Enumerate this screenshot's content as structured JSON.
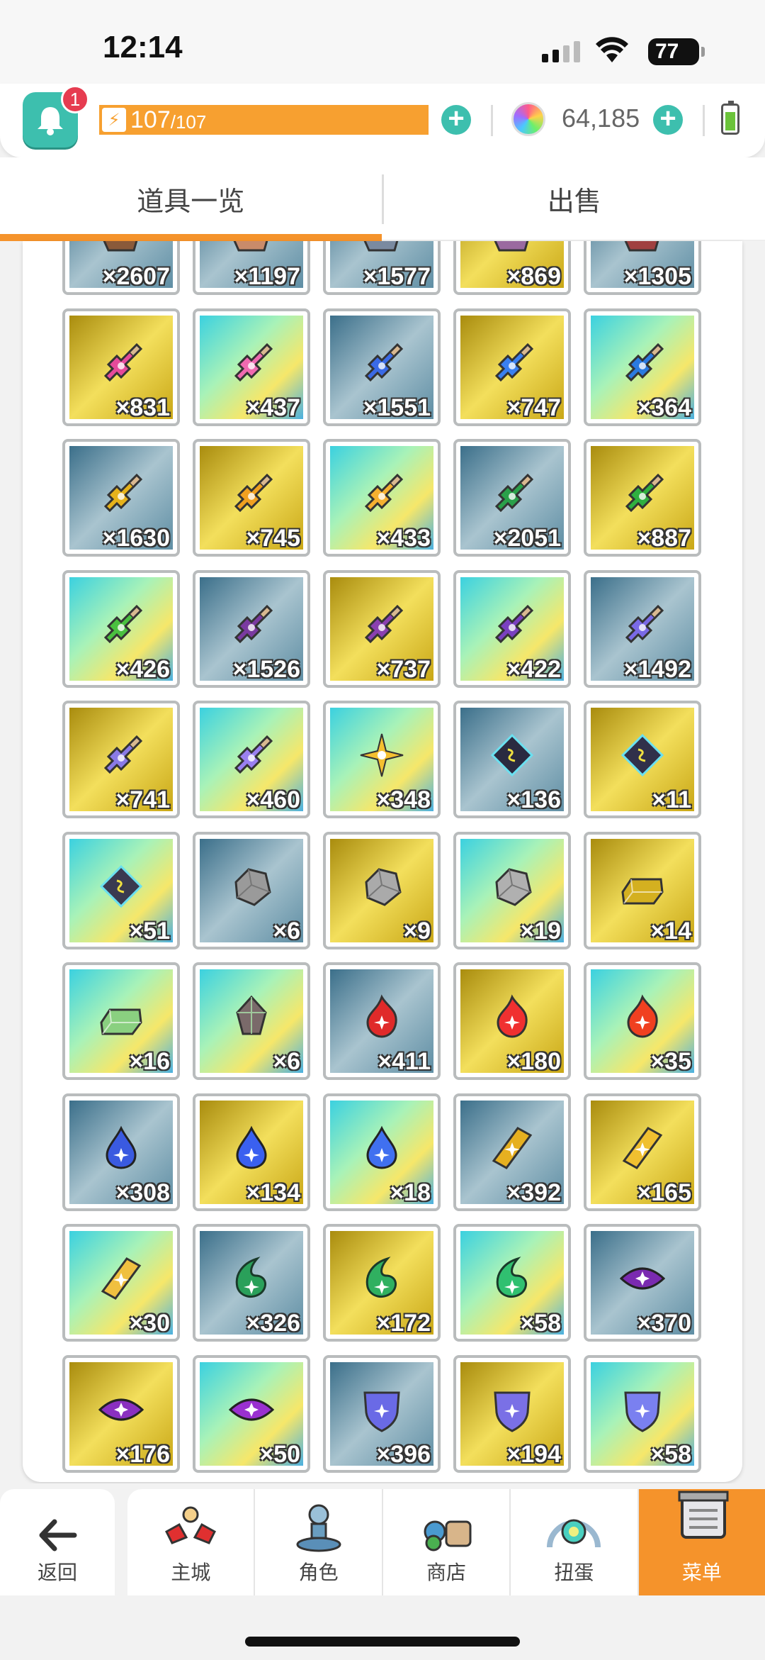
{
  "status_bar": {
    "time": "12:14",
    "battery": "77"
  },
  "header": {
    "notification_count": "1",
    "stamina_current": "107",
    "stamina_max": "/107",
    "gems": "64,185"
  },
  "tabs": [
    {
      "label": "道具一览",
      "active": true
    },
    {
      "label": "出售",
      "active": false
    }
  ],
  "items": [
    {
      "count": "×2607",
      "bg": "r",
      "icon": "material-icon",
      "color": "#8a5a3a"
    },
    {
      "count": "×1197",
      "bg": "r",
      "icon": "material-icon",
      "color": "#c98b6a"
    },
    {
      "count": "×1577",
      "bg": "r",
      "icon": "material-icon",
      "color": "#7a8aa0"
    },
    {
      "count": "×869",
      "bg": "s",
      "icon": "material-icon",
      "color": "#9a6aa0"
    },
    {
      "count": "×1305",
      "bg": "r",
      "icon": "material-icon",
      "color": "#a04040"
    },
    {
      "count": "×831",
      "bg": "s",
      "icon": "potion-icon",
      "color": "#e64a9a"
    },
    {
      "count": "×437",
      "bg": "u",
      "icon": "potion-icon",
      "color": "#f06ab0"
    },
    {
      "count": "×1551",
      "bg": "r",
      "icon": "potion-icon",
      "color": "#3a6ae6"
    },
    {
      "count": "×747",
      "bg": "s",
      "icon": "potion-icon",
      "color": "#3a80f0"
    },
    {
      "count": "×364",
      "bg": "u",
      "icon": "potion-icon",
      "color": "#2a7ae0"
    },
    {
      "count": "×1630",
      "bg": "r",
      "icon": "potion-icon",
      "color": "#e6b21a"
    },
    {
      "count": "×745",
      "bg": "s",
      "icon": "potion-icon",
      "color": "#f0a020"
    },
    {
      "count": "×433",
      "bg": "u",
      "icon": "potion-icon",
      "color": "#f5b030"
    },
    {
      "count": "×2051",
      "bg": "r",
      "icon": "potion-icon",
      "color": "#2aa04a"
    },
    {
      "count": "×887",
      "bg": "s",
      "icon": "potion-icon",
      "color": "#30b040"
    },
    {
      "count": "×426",
      "bg": "u",
      "icon": "potion-icon",
      "color": "#4ac040"
    },
    {
      "count": "×1526",
      "bg": "r",
      "icon": "potion-icon",
      "color": "#7a3aa0"
    },
    {
      "count": "×737",
      "bg": "s",
      "icon": "potion-icon",
      "color": "#8a40b0"
    },
    {
      "count": "×422",
      "bg": "u",
      "icon": "potion-icon",
      "color": "#7a40c0"
    },
    {
      "count": "×1492",
      "bg": "r",
      "icon": "potion-icon",
      "color": "#7a6ae6"
    },
    {
      "count": "×741",
      "bg": "s",
      "icon": "potion-icon",
      "color": "#8a7ae6"
    },
    {
      "count": "×460",
      "bg": "u",
      "icon": "potion-icon",
      "color": "#9a80f0"
    },
    {
      "count": "×348",
      "bg": "u",
      "icon": "sparkle-icon",
      "color": "#f5c030"
    },
    {
      "count": "×136",
      "bg": "r",
      "icon": "rune-icon",
      "color": "#2a2a40"
    },
    {
      "count": "×11",
      "bg": "s",
      "icon": "rune-icon",
      "color": "#30304a"
    },
    {
      "count": "×51",
      "bg": "u",
      "icon": "rune-icon",
      "color": "#3a3a50"
    },
    {
      "count": "×6",
      "bg": "r",
      "icon": "ore-icon",
      "color": "#9a9a9a"
    },
    {
      "count": "×9",
      "bg": "s",
      "icon": "ore-icon",
      "color": "#aaaaaa"
    },
    {
      "count": "×19",
      "bg": "u",
      "icon": "ore-icon",
      "color": "#b0b0b0"
    },
    {
      "count": "×14",
      "bg": "s",
      "icon": "ingot-icon",
      "color": "#d4b020"
    },
    {
      "count": "×16",
      "bg": "u",
      "icon": "ingot-icon",
      "color": "#8ad080"
    },
    {
      "count": "×6",
      "bg": "u",
      "icon": "crystal-icon",
      "color": "#7a6a6a"
    },
    {
      "count": "×411",
      "bg": "r",
      "icon": "fire-icon",
      "color": "#e02a2a"
    },
    {
      "count": "×180",
      "bg": "s",
      "icon": "fire-icon",
      "color": "#f03030"
    },
    {
      "count": "×35",
      "bg": "u",
      "icon": "fire-icon",
      "color": "#f04020"
    },
    {
      "count": "×308",
      "bg": "r",
      "icon": "drop-icon",
      "color": "#3a5ae0"
    },
    {
      "count": "×134",
      "bg": "s",
      "icon": "drop-icon",
      "color": "#3a60f0"
    },
    {
      "count": "×18",
      "bg": "u",
      "icon": "drop-icon",
      "color": "#4070f0"
    },
    {
      "count": "×392",
      "bg": "r",
      "icon": "gem-icon",
      "color": "#e6b020"
    },
    {
      "count": "×165",
      "bg": "s",
      "icon": "gem-icon",
      "color": "#f0c030"
    },
    {
      "count": "×30",
      "bg": "u",
      "icon": "gem-icon",
      "color": "#f0c040"
    },
    {
      "count": "×326",
      "bg": "r",
      "icon": "leaf-icon",
      "color": "#2aa05a"
    },
    {
      "count": "×172",
      "bg": "s",
      "icon": "leaf-icon",
      "color": "#30b060"
    },
    {
      "count": "×58",
      "bg": "u",
      "icon": "leaf-icon",
      "color": "#30c070"
    },
    {
      "count": "×370",
      "bg": "r",
      "icon": "eye-icon",
      "color": "#7a2ab0"
    },
    {
      "count": "×176",
      "bg": "s",
      "icon": "eye-icon",
      "color": "#8a30c0"
    },
    {
      "count": "×50",
      "bg": "u",
      "icon": "eye-icon",
      "color": "#9a30d0"
    },
    {
      "count": "×396",
      "bg": "r",
      "icon": "shield-icon",
      "color": "#6a6ae6"
    },
    {
      "count": "×194",
      "bg": "s",
      "icon": "shield-icon",
      "color": "#7a70e6"
    },
    {
      "count": "×58",
      "bg": "u",
      "icon": "shield-icon",
      "color": "#7a80f0"
    }
  ],
  "bottom_nav": {
    "back": "返回",
    "items": [
      {
        "label": "主城",
        "icon": "town-icon"
      },
      {
        "label": "角色",
        "icon": "character-icon"
      },
      {
        "label": "商店",
        "icon": "shop-icon"
      },
      {
        "label": "扭蛋",
        "icon": "gacha-icon"
      },
      {
        "label": "菜单",
        "icon": "menu-icon",
        "active": true
      }
    ]
  }
}
